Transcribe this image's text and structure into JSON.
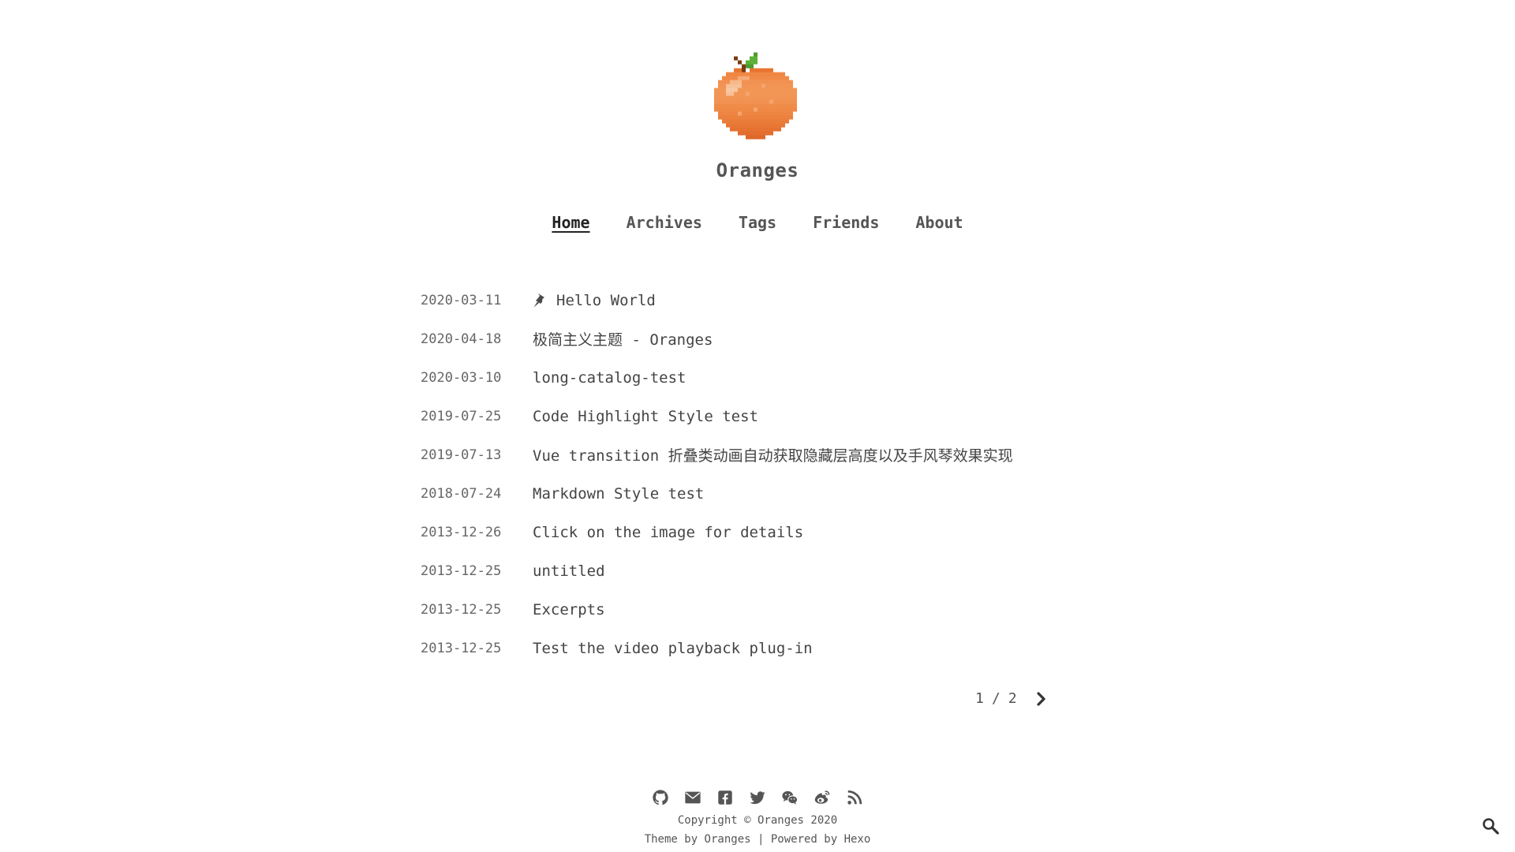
{
  "site": {
    "title": "Oranges"
  },
  "nav": {
    "items": [
      {
        "label": "Home",
        "active": true
      },
      {
        "label": "Archives",
        "active": false
      },
      {
        "label": "Tags",
        "active": false
      },
      {
        "label": "Friends",
        "active": false
      },
      {
        "label": "About",
        "active": false
      }
    ]
  },
  "posts": [
    {
      "date": "2020-03-11",
      "title": "Hello World",
      "pinned": true
    },
    {
      "date": "2020-04-18",
      "title": "极简主义主题 - Oranges",
      "pinned": false
    },
    {
      "date": "2020-03-10",
      "title": "long-catalog-test",
      "pinned": false
    },
    {
      "date": "2019-07-25",
      "title": "Code Highlight Style test",
      "pinned": false
    },
    {
      "date": "2019-07-13",
      "title": "Vue transition 折叠类动画自动获取隐藏层高度以及手风琴效果实现",
      "pinned": false
    },
    {
      "date": "2018-07-24",
      "title": "Markdown Style test",
      "pinned": false
    },
    {
      "date": "2013-12-26",
      "title": "Click on the image for details",
      "pinned": false
    },
    {
      "date": "2013-12-25",
      "title": "untitled",
      "pinned": false
    },
    {
      "date": "2013-12-25",
      "title": "Excerpts",
      "pinned": false
    },
    {
      "date": "2013-12-25",
      "title": "Test the video playback plug-in",
      "pinned": false
    }
  ],
  "pagination": {
    "current": "1",
    "separator": "/",
    "total": "2",
    "next_icon": "chevron-right-icon"
  },
  "footer": {
    "social_icons": [
      "github-icon",
      "email-icon",
      "facebook-icon",
      "twitter-icon",
      "wechat-icon",
      "weibo-icon",
      "rss-icon"
    ],
    "copyright": "Copyright © Oranges 2020",
    "theme_line": "Theme by Oranges | Powered by Hexo"
  },
  "colors": {
    "text": "#4a4a4a",
    "background": "#ffffff",
    "orange": "#f0894a"
  }
}
